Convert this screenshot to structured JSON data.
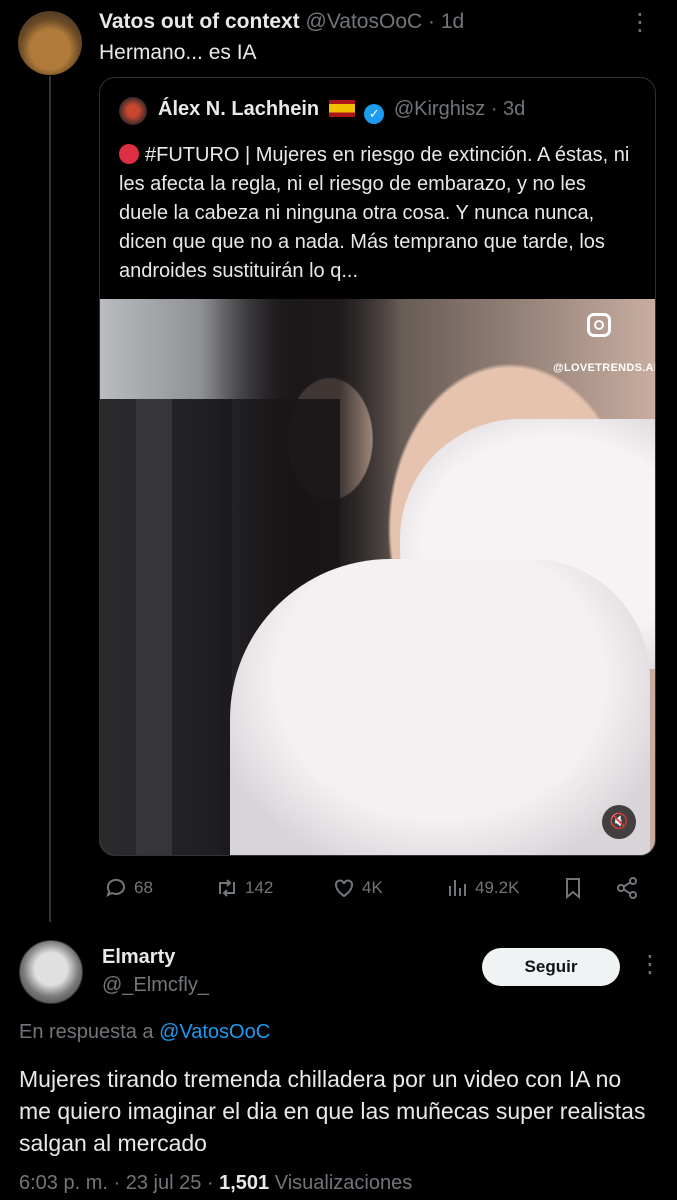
{
  "top_tweet": {
    "name": "Vatos out of context",
    "handle": "@VatosOoC",
    "time": "· 1d",
    "text": "Hermano... es IA"
  },
  "quote": {
    "name": "Álex N. Lachhein",
    "handle": "@Kirghisz",
    "time": "· 3d",
    "text": "#FUTURO | Mujeres en riesgo de extinción. A éstas, ni les afecta la regla, ni el riesgo de embarazo, y no les duele la cabeza ni ninguna otra cosa. Y nunca nunca, dicen que que no a nada. Más temprano que tarde, los androides sustituirán lo q...",
    "media_watermark": "@LOVETRENDS.AI"
  },
  "actions": {
    "replies": "68",
    "retweets": "142",
    "likes": "4K",
    "views": "49.2K"
  },
  "reply": {
    "name": "Elmarty",
    "handle": "@_Elmcfly_",
    "follow_label": "Seguir",
    "reply_prefix": "En respuesta a",
    "reply_to": "@VatosOoC",
    "text": "Mujeres tirando tremenda chilladera por un video con IA no me quiero imaginar el dia en que las muñecas super realistas salgan al mercado",
    "time": "6:03 p. m.",
    "date": "23 jul 25",
    "views_count": "1,501",
    "views_label": "Visualizaciones"
  },
  "icons": [
    "more-icon",
    "verified-icon",
    "spain-flag-icon",
    "instagram-icon",
    "mute-icon",
    "reply-icon",
    "retweet-icon",
    "like-icon",
    "views-icon",
    "bookmark-icon",
    "share-icon"
  ],
  "colors": {
    "background": "#000000",
    "text": "#e7e9ea",
    "muted": "#71767b",
    "link": "#1d9bf0"
  }
}
